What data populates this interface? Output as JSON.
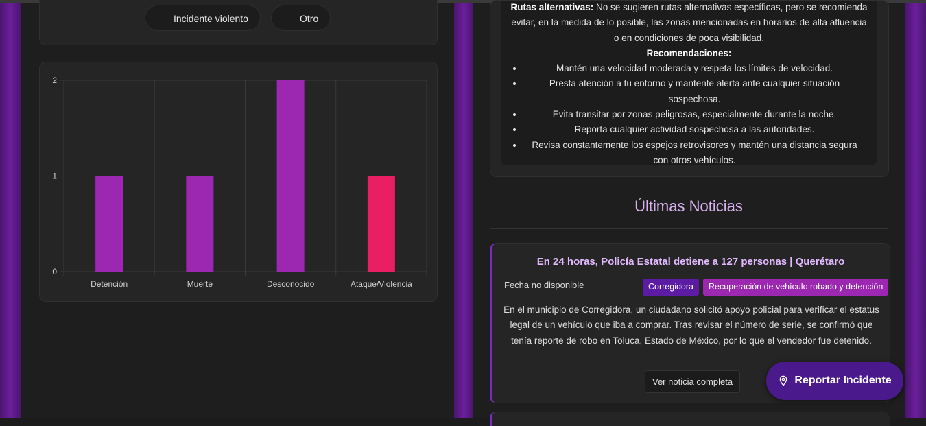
{
  "colors": {
    "accent": "#9c27b0",
    "accent_alt": "#e91e63",
    "brand_dark": "#4a1a8c",
    "title": "#d9b3f0"
  },
  "filters": {
    "items": [
      {
        "label": "Incidente violento"
      },
      {
        "label": "Otro"
      }
    ]
  },
  "info": {
    "alt_routes_heading": "Rutas alternativas:",
    "alt_routes_text": "No se sugieren rutas alternativas específicas, pero se recomienda evitar, en la medida de lo posible, las zonas mencionadas en horarios de alta afluencia o en condiciones de poca visibilidad.",
    "recommendations_heading": "Recomendaciones:",
    "recommendations": [
      "Mantén una velocidad moderada y respeta los límites de velocidad.",
      "Presta atención a tu entorno y mantente alerta ante cualquier situación sospechosa.",
      "Evita transitar por zonas peligrosas, especialmente durante la noche.",
      "Reporta cualquier actividad sospechosa a las autoridades.",
      "Revisa constantemente los espejos retrovisores y mantén una distancia segura con otros vehículos."
    ]
  },
  "news": {
    "section_title": "Últimas Noticias",
    "items": [
      {
        "title": "En 24 horas, Policía Estatal detiene a 127 personas | Querétaro",
        "date": "Fecha no disponible",
        "tags": [
          "Corregidora",
          "Recuperación de vehículo robado y detención"
        ],
        "summary": "En el municipio de Corregidora, un ciudadano solicitó apoyo policial para verificar el estatus legal de un vehículo que iba a comprar. Tras revisar el número de serie, se confirmó que tenía reporte de robo en Toluca, Estado de México, por lo que el vendedor fue detenido.",
        "button": "Ver noticia completa"
      }
    ]
  },
  "report_button": {
    "label": "Reportar Incidente",
    "icon": "map-pin-icon"
  },
  "chart_data": {
    "type": "bar",
    "categories": [
      "Detención",
      "Muerte",
      "Desconocido",
      "Ataque/Violencia"
    ],
    "values": [
      1,
      1,
      2,
      1
    ],
    "colors": [
      "#9c27b0",
      "#9c27b0",
      "#9c27b0",
      "#e91e63"
    ],
    "yticks": [
      0,
      1,
      2
    ],
    "ylim": [
      0,
      2
    ],
    "grid": true,
    "title": "",
    "xlabel": "",
    "ylabel": ""
  }
}
